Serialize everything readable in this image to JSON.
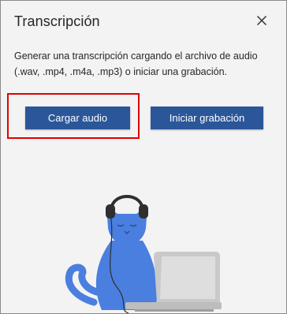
{
  "panel": {
    "title": "Transcripción",
    "close_label": "Cerrar",
    "description": "Generar una transcripción cargando el archivo de audio (.wav, .mp4, .m4a, .mp3) o iniciar una grabación.",
    "upload_button": "Cargar audio",
    "record_button": "Iniciar grabación"
  },
  "colors": {
    "accent": "#2b579a",
    "highlight": "#e00000",
    "cat": "#4a7fe0",
    "pane_background": "#f3f3f3"
  },
  "icons": {
    "close": "close-icon"
  }
}
